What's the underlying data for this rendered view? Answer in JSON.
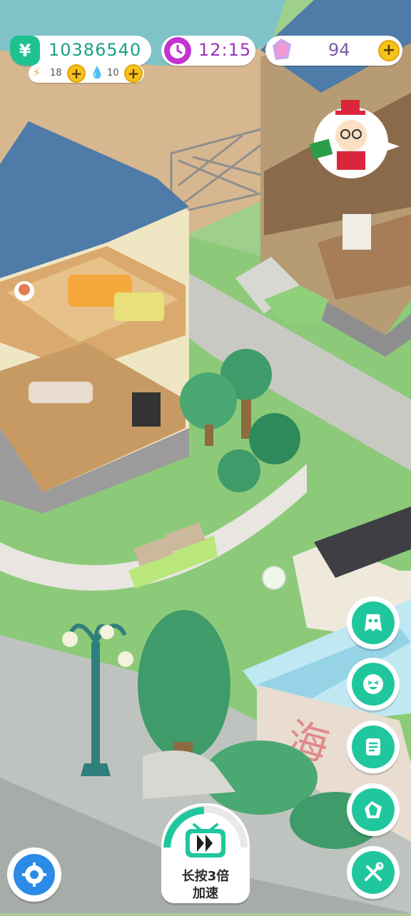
{
  "hud": {
    "money": "10386540",
    "money_icon": "yuan-icon",
    "energy_count": "18",
    "water_count": "10",
    "time": "12:15",
    "gems": "94"
  },
  "speed_button": {
    "line1": "长按3倍",
    "line2": "加速"
  },
  "side_buttons": [
    "ghost-icon",
    "laugh-face-icon",
    "list-note-icon",
    "gem-icon",
    "tools-icon"
  ],
  "colors": {
    "accent_green": "#20c79e",
    "money_green": "#1aa184",
    "clock_purple": "#9a33b9",
    "gold": "#f7c21a"
  },
  "scene": {
    "pool_sign_text": "海"
  }
}
